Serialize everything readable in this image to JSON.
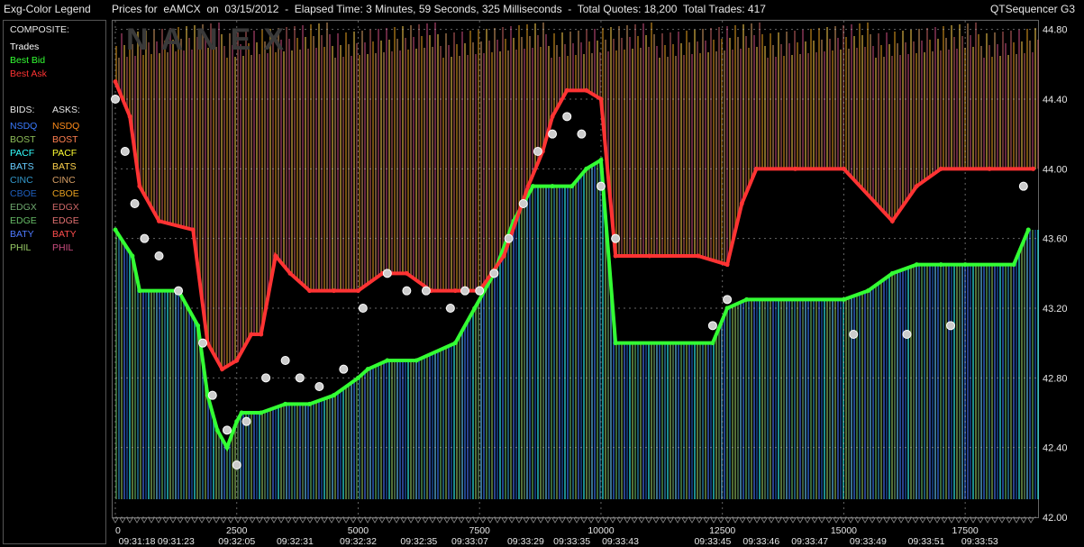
{
  "window": {
    "legend_title": "Exg-Color Legend",
    "main_title": "Prices for  eAMCX  on  03/15/2012  -  Elapsed Time: 3 Minutes, 59 Seconds, 325 Milliseconds  -  Total Quotes: 18,200  Total Trades: 417",
    "app_name": "QTSequencer G3"
  },
  "legend": {
    "composite_label": "COMPOSITE:",
    "composite": [
      {
        "label": "Trades",
        "color": "#ffffff"
      },
      {
        "label": "Best Bid",
        "color": "#33ff33"
      },
      {
        "label": "Best Ask",
        "color": "#ff3333"
      }
    ],
    "bids_label": "BIDS:",
    "asks_label": "ASKS:",
    "exchanges": [
      {
        "bid": "NSDQ",
        "ask": "NSDQ",
        "bid_color": "#3a7bff",
        "ask_color": "#ff8c1a"
      },
      {
        "bid": "BOST",
        "ask": "BOST",
        "bid_color": "#8fbf5a",
        "ask_color": "#ff7f50"
      },
      {
        "bid": "PACF",
        "ask": "PACF",
        "bid_color": "#33ffff",
        "ask_color": "#ffff33"
      },
      {
        "bid": "BATS",
        "ask": "BATS",
        "bid_color": "#66ccff",
        "ask_color": "#ffd24d"
      },
      {
        "bid": "CINC",
        "ask": "CINC",
        "bid_color": "#3399cc",
        "ask_color": "#d9a066"
      },
      {
        "bid": "CBOE",
        "ask": "CBOE",
        "bid_color": "#1f5fbf",
        "ask_color": "#e6a020"
      },
      {
        "bid": "EDGX",
        "ask": "EDGX",
        "bid_color": "#6fa86f",
        "ask_color": "#cc6666"
      },
      {
        "bid": "EDGE",
        "ask": "EDGE",
        "bid_color": "#66bb66",
        "ask_color": "#e07070"
      },
      {
        "bid": "BATY",
        "ask": "BATY",
        "bid_color": "#4d79ff",
        "ask_color": "#ff4d4d"
      },
      {
        "bid": "PHIL",
        "ask": "PHIL",
        "bid_color": "#99cc66",
        "ask_color": "#cc4d80"
      }
    ]
  },
  "chart_data": {
    "type": "line",
    "watermark": "NANEX",
    "xlim": [
      0,
      19000
    ],
    "ylim": [
      42.0,
      44.85
    ],
    "y_ticks": [
      "44.80",
      "44.40",
      "44.00",
      "43.60",
      "43.20",
      "42.80",
      "42.40",
      "42.00"
    ],
    "y_tick_values": [
      44.8,
      44.4,
      44.0,
      43.6,
      43.2,
      42.8,
      42.4,
      42.0
    ],
    "x_ticks": [
      "0",
      "2500",
      "5000",
      "7500",
      "10000",
      "12500",
      "15000",
      "17500"
    ],
    "x_tick_values": [
      0,
      2500,
      5000,
      7500,
      10000,
      12500,
      15000,
      17500
    ],
    "time_labels": [
      "09:31:18",
      "09:31:23",
      "09:32:05",
      "09:32:31",
      "09:32:32",
      "09:32:35",
      "09:33:07",
      "09:33:29",
      "09:33:35",
      "09:33:43",
      "09:33:45",
      "09:33:46",
      "09:33:47",
      "09:33:49",
      "09:33:51",
      "09:33:53"
    ],
    "time_label_values": [
      0,
      1250,
      2500,
      3700,
      5000,
      6250,
      7300,
      8450,
      9400,
      10400,
      12300,
      13300,
      14300,
      15500,
      16700,
      17800
    ],
    "series": [
      {
        "name": "Best Bid",
        "color": "#33ff33",
        "x": [
          0,
          350,
          500,
          1300,
          1700,
          1900,
          2100,
          2300,
          2500,
          2600,
          3000,
          3500,
          4000,
          4500,
          5000,
          5200,
          5600,
          6200,
          7000,
          7400,
          7800,
          8200,
          8600,
          9000,
          9400,
          9700,
          10000,
          10300,
          12300,
          12600,
          13000,
          15000,
          15500,
          16000,
          16500,
          17000,
          17500,
          18500,
          18800
        ],
        "y": [
          43.65,
          43.5,
          43.3,
          43.3,
          43.1,
          42.7,
          42.5,
          42.4,
          42.55,
          42.6,
          42.6,
          42.65,
          42.65,
          42.7,
          42.8,
          42.85,
          42.9,
          42.9,
          43.0,
          43.2,
          43.4,
          43.7,
          43.9,
          43.9,
          43.9,
          44.0,
          44.05,
          43.0,
          43.0,
          43.2,
          43.25,
          43.25,
          43.3,
          43.4,
          43.45,
          43.45,
          43.45,
          43.45,
          43.65
        ]
      },
      {
        "name": "Best Ask",
        "color": "#ff3333",
        "x": [
          0,
          300,
          500,
          900,
          1600,
          1900,
          2200,
          2500,
          2800,
          3000,
          3300,
          3600,
          4000,
          4500,
          5000,
          5500,
          6000,
          6500,
          7000,
          7500,
          8000,
          8500,
          8800,
          9000,
          9300,
          9700,
          10000,
          10300,
          11000,
          12000,
          12600,
          12900,
          13200,
          14000,
          15000,
          16000,
          16500,
          17000,
          18000,
          18900
        ],
        "y": [
          44.5,
          44.3,
          43.9,
          43.7,
          43.65,
          43.0,
          42.85,
          42.9,
          43.05,
          43.05,
          43.5,
          43.4,
          43.3,
          43.3,
          43.3,
          43.4,
          43.4,
          43.3,
          43.3,
          43.3,
          43.5,
          43.9,
          44.1,
          44.3,
          44.45,
          44.45,
          44.4,
          43.5,
          43.5,
          43.5,
          43.45,
          43.8,
          44.0,
          44.0,
          44.0,
          43.7,
          43.9,
          44.0,
          44.0,
          44.0
        ]
      },
      {
        "name": "Trades",
        "color": "#ffffff",
        "x": [
          0,
          200,
          400,
          600,
          900,
          1300,
          1800,
          2000,
          2300,
          2500,
          2700,
          3100,
          3500,
          3800,
          4200,
          4700,
          5100,
          5600,
          6000,
          6400,
          6900,
          7200,
          7500,
          7800,
          8100,
          8400,
          8700,
          9000,
          9300,
          9600,
          10000,
          10300,
          12300,
          12600,
          15200,
          16300,
          17200,
          18700
        ],
        "y": [
          44.4,
          44.1,
          43.8,
          43.6,
          43.5,
          43.3,
          43.0,
          42.7,
          42.5,
          42.3,
          42.55,
          42.8,
          42.9,
          42.8,
          42.75,
          42.85,
          43.2,
          43.4,
          43.3,
          43.3,
          43.2,
          43.3,
          43.3,
          43.4,
          43.6,
          43.8,
          44.1,
          44.2,
          44.3,
          44.2,
          43.9,
          43.6,
          43.1,
          43.25,
          43.05,
          43.05,
          43.1,
          43.9
        ]
      }
    ]
  }
}
